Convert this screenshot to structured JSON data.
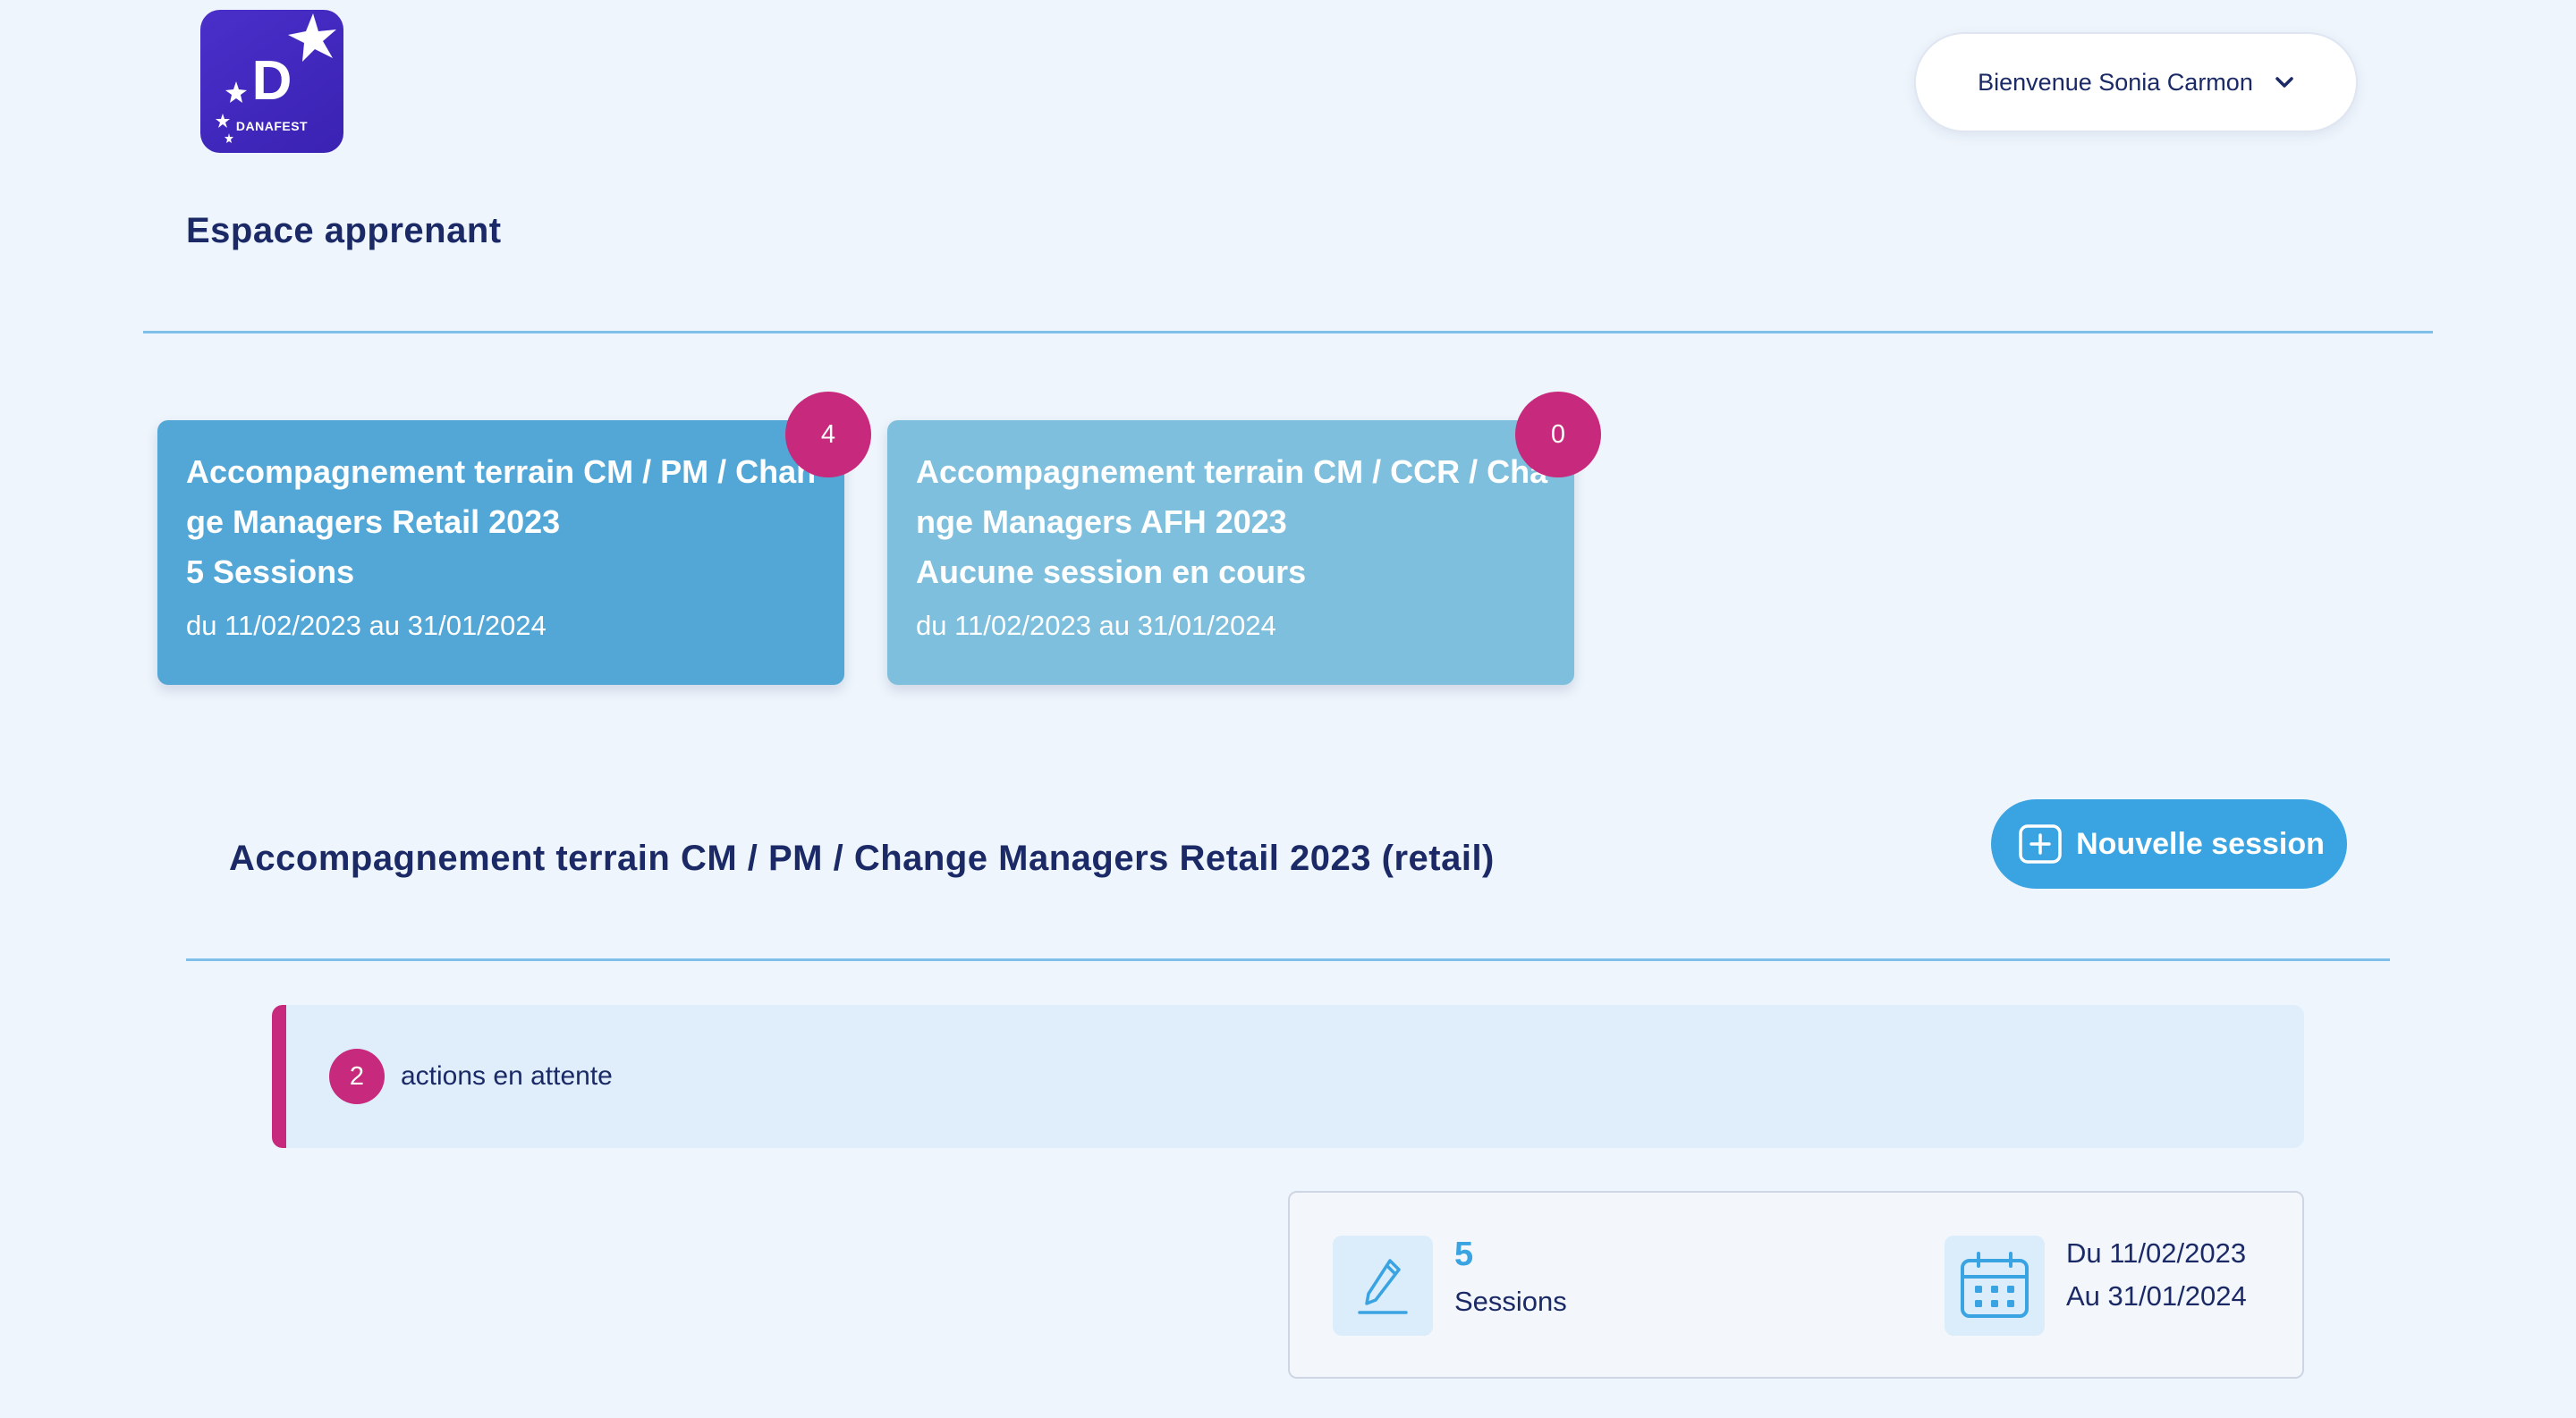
{
  "brand": {
    "logo_letter": "D",
    "logo_word": "DANAFEST"
  },
  "header": {
    "welcome": "Bienvenue Sonia Carmon"
  },
  "page": {
    "title": "Espace apprenant"
  },
  "programs": [
    {
      "title": "Accompagnement terrain CM / PM / Change Managers Retail 2023",
      "sessions": "5 Sessions",
      "dates": "du 11/02/2023 au 31/01/2024",
      "badge": "4"
    },
    {
      "title": "Accompagnement terrain CM / CCR / Change Managers AFH 2023",
      "sessions": "Aucune session en cours",
      "dates": "du 11/02/2023 au 31/01/2024",
      "badge": "0"
    }
  ],
  "section": {
    "title": "Accompagnement terrain CM / PM / Change Managers Retail 2023 (retail)",
    "new_session_label": "Nouvelle session"
  },
  "pending": {
    "count": "2",
    "label": "actions en attente"
  },
  "stats": {
    "sessions_count": "5",
    "sessions_label": "Sessions",
    "date_from": "Du 11/02/2023",
    "date_to": "Au 31/01/2024"
  },
  "colors": {
    "background": "#eef5fc",
    "navy": "#1b2a66",
    "accent_blue": "#3aa3e2",
    "card_active": "#52a7d6",
    "card_inactive": "#7dbfdc",
    "badge_magenta": "#c72a7c",
    "brand_purple": "#3a22b3"
  },
  "icons": {
    "user_menu": "chevron-down-icon",
    "new_session": "plus-square-icon",
    "sessions": "pencil-icon",
    "dates": "calendar-icon"
  }
}
